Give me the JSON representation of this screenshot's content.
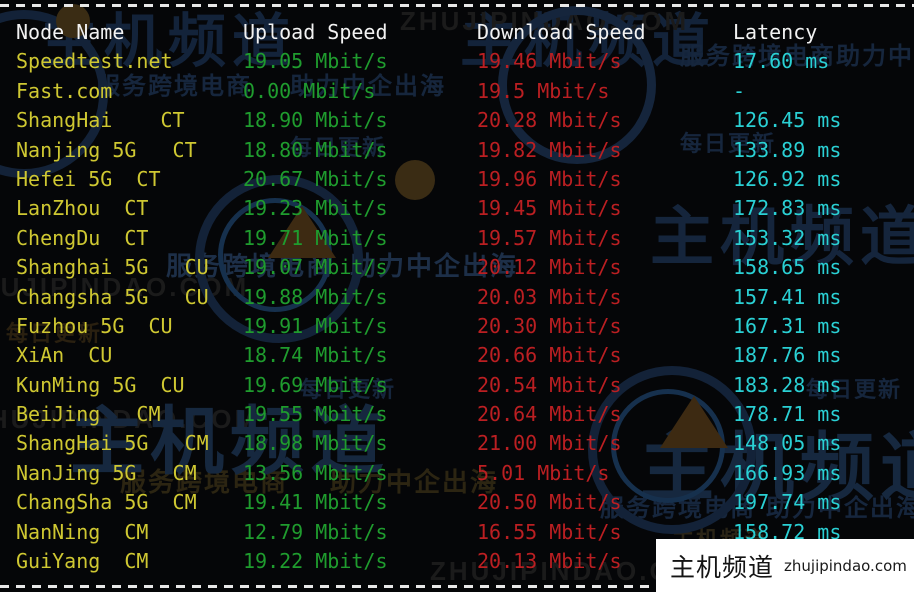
{
  "terminal": {
    "columns": {
      "node_name": "Node Name",
      "upload_speed": "Upload Speed",
      "download_speed": "Download Speed",
      "latency": "Latency"
    },
    "colors": {
      "background": "#050608",
      "header_text": "#f2f2f2",
      "node_name": "#cfc832",
      "upload": "#1f9c2e",
      "download": "#bb1f22",
      "latency": "#2ad0d4",
      "rule": "#e8e8e8"
    },
    "rows": [
      {
        "node": "Speedtest.net",
        "upload": "19.05 Mbit/s",
        "download": "19.46 Mbit/s",
        "latency": "17.60 ms"
      },
      {
        "node": "Fast.com",
        "upload": "0.00 Mbit/s",
        "download": "19.5 Mbit/s",
        "latency": "-"
      },
      {
        "node": "ShangHai    CT",
        "upload": "18.90 Mbit/s",
        "download": "20.28 Mbit/s",
        "latency": "126.45 ms"
      },
      {
        "node": "Nanjing 5G   CT",
        "upload": "18.80 Mbit/s",
        "download": "19.82 Mbit/s",
        "latency": "133.89 ms"
      },
      {
        "node": "Hefei 5G  CT",
        "upload": "20.67 Mbit/s",
        "download": "19.96 Mbit/s",
        "latency": "126.92 ms"
      },
      {
        "node": "LanZhou  CT",
        "upload": "19.23 Mbit/s",
        "download": "19.45 Mbit/s",
        "latency": "172.83 ms"
      },
      {
        "node": "ChengDu  CT",
        "upload": "19.71 Mbit/s",
        "download": "19.57 Mbit/s",
        "latency": "153.32 ms"
      },
      {
        "node": "Shanghai 5G   CU",
        "upload": "19.07 Mbit/s",
        "download": "20.12 Mbit/s",
        "latency": "158.65 ms"
      },
      {
        "node": "Changsha 5G   CU",
        "upload": "19.88 Mbit/s",
        "download": "20.03 Mbit/s",
        "latency": "157.41 ms"
      },
      {
        "node": "Fuzhou 5G  CU",
        "upload": "19.91 Mbit/s",
        "download": "20.30 Mbit/s",
        "latency": "167.31 ms"
      },
      {
        "node": "XiAn  CU",
        "upload": "18.74 Mbit/s",
        "download": "20.66 Mbit/s",
        "latency": "187.76 ms"
      },
      {
        "node": "KunMing 5G  CU",
        "upload": "19.69 Mbit/s",
        "download": "20.54 Mbit/s",
        "latency": "183.28 ms"
      },
      {
        "node": "BeiJing   CM",
        "upload": "19.55 Mbit/s",
        "download": "20.64 Mbit/s",
        "latency": "178.71 ms"
      },
      {
        "node": "ShangHai 5G   CM",
        "upload": "18.98 Mbit/s",
        "download": "21.00 Mbit/s",
        "latency": "148.05 ms"
      },
      {
        "node": "NanJing 5G   CM",
        "upload": "13.56 Mbit/s",
        "download": "5.01 Mbit/s",
        "latency": "166.93 ms"
      },
      {
        "node": "ChangSha 5G  CM",
        "upload": "19.41 Mbit/s",
        "download": "20.50 Mbit/s",
        "latency": "197.74 ms"
      },
      {
        "node": "NanNing  CM",
        "upload": "12.79 Mbit/s",
        "download": "16.55 Mbit/s",
        "latency": "158.72 ms"
      },
      {
        "node": "GuiYang  CM",
        "upload": "19.22 Mbit/s",
        "download": "20.13 Mbit/s",
        "latency": ""
      }
    ]
  },
  "logo": {
    "brand_cn": "主机频道",
    "brand_url": "zhujipindao.com"
  },
  "watermarks": {
    "cn_service": "服务跨境电商",
    "cn_help": "助力中企出海",
    "cn_daily": "每日更新",
    "cn_channel": "主机频道",
    "latin": "ZHUJIPINDAO.COM"
  }
}
